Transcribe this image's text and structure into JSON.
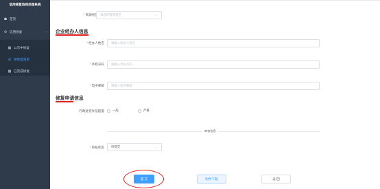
{
  "sidebar": {
    "title": "信用修复协同处理系统",
    "home": {
      "label": "首页",
      "icon": "home-icon"
    },
    "group": {
      "label": "信用修复",
      "icon": "credit-icon",
      "chevron": "chevron-up-icon"
    },
    "items": [
      {
        "label": "公示中修复",
        "icon": "grid-icon"
      },
      {
        "label": "待修复清单",
        "icon": "list-icon"
      },
      {
        "label": "已完成修复",
        "icon": "grid-icon"
      }
    ]
  },
  "form": {
    "region": {
      "label": "资源县区",
      "placeholder": "请选择管理县区"
    },
    "section1_title": "企业经办人信息",
    "agent_name": {
      "label": "经办人姓名",
      "placeholder": "请输入经办人姓名"
    },
    "phone": {
      "label": "手机号码",
      "placeholder": "请输入手机号码"
    },
    "email": {
      "label": "电子邮箱",
      "placeholder": "请输入电子邮箱"
    },
    "section2_title": "修复申请信息",
    "penalty_level": {
      "label": "行政处罚失信程度",
      "options": [
        "一般",
        "严重"
      ]
    },
    "divider_text": "审核信息",
    "review_status": {
      "label": "审核状态",
      "value": "待提交"
    }
  },
  "actions": {
    "submit": "提 交",
    "download": "附件下载",
    "back": "返 回"
  },
  "colors": {
    "sidebar_bg": "#2f3b4b",
    "accent": "#409eff",
    "annotation": "#e02020"
  }
}
